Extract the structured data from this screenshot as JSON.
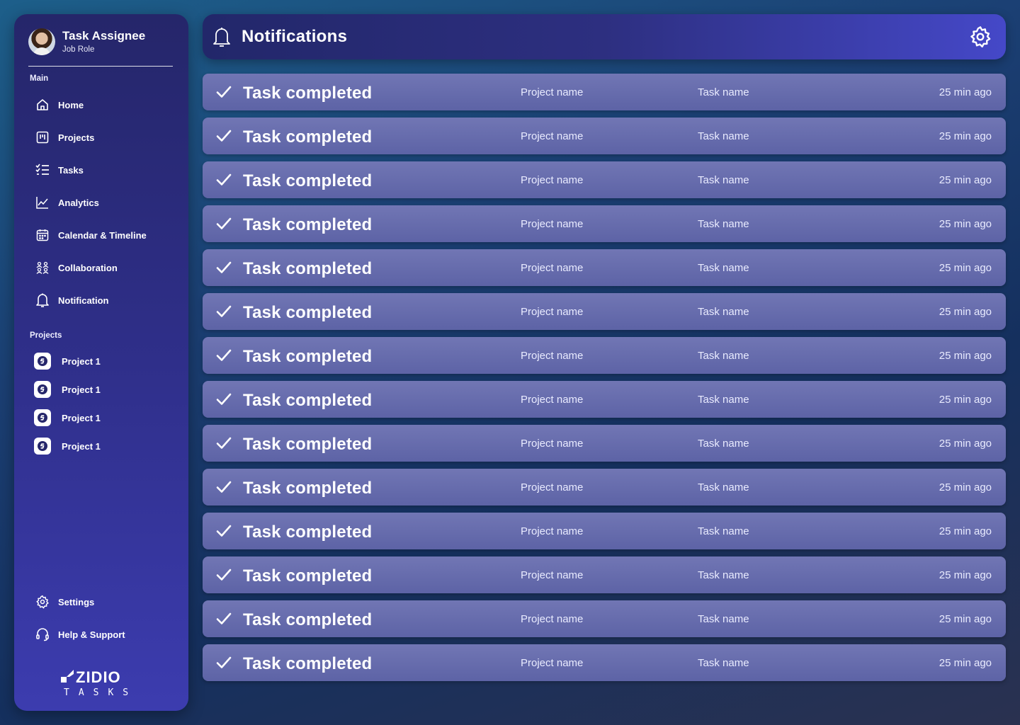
{
  "user": {
    "name": "Task Assignee",
    "role": "Job Role"
  },
  "sidebar": {
    "main_label": "Main",
    "nav": [
      {
        "label": "Home",
        "icon": "home-icon"
      },
      {
        "label": "Projects",
        "icon": "kanban-icon"
      },
      {
        "label": "Tasks",
        "icon": "tasks-icon"
      },
      {
        "label": "Analytics",
        "icon": "analytics-icon"
      },
      {
        "label": "Calendar & Timeline",
        "icon": "calendar-icon"
      },
      {
        "label": "Collaboration",
        "icon": "collaboration-icon"
      },
      {
        "label": "Notification",
        "icon": "bell-icon"
      }
    ],
    "projects_label": "Projects",
    "projects": [
      {
        "label": "Project 1",
        "icon": "project-s-icon"
      },
      {
        "label": "Project 1",
        "icon": "project-s-icon"
      },
      {
        "label": "Project 1",
        "icon": "project-s-icon"
      },
      {
        "label": "Project 1",
        "icon": "project-s-icon"
      }
    ],
    "bottom": [
      {
        "label": "Settings",
        "icon": "gear-icon"
      },
      {
        "label": "Help & Support",
        "icon": "headset-icon"
      }
    ],
    "logo": {
      "word": "ZIDIO",
      "sub": "TASKS"
    }
  },
  "header": {
    "title": "Notifications",
    "bell_icon": "bell-icon",
    "settings_icon": "gear-icon"
  },
  "notifications": [
    {
      "title": "Task completed",
      "project": "Project name",
      "task": "Task name",
      "time": "25 min ago",
      "icon": "check-icon"
    },
    {
      "title": "Task completed",
      "project": "Project name",
      "task": "Task name",
      "time": "25 min ago",
      "icon": "check-icon"
    },
    {
      "title": "Task completed",
      "project": "Project name",
      "task": "Task name",
      "time": "25 min ago",
      "icon": "check-icon"
    },
    {
      "title": "Task completed",
      "project": "Project name",
      "task": "Task name",
      "time": "25 min ago",
      "icon": "check-icon"
    },
    {
      "title": "Task completed",
      "project": "Project name",
      "task": "Task name",
      "time": "25 min ago",
      "icon": "check-icon"
    },
    {
      "title": "Task completed",
      "project": "Project name",
      "task": "Task name",
      "time": "25 min ago",
      "icon": "check-icon"
    },
    {
      "title": "Task completed",
      "project": "Project name",
      "task": "Task name",
      "time": "25 min ago",
      "icon": "check-icon"
    },
    {
      "title": "Task completed",
      "project": "Project name",
      "task": "Task name",
      "time": "25 min ago",
      "icon": "check-icon"
    },
    {
      "title": "Task completed",
      "project": "Project name",
      "task": "Task name",
      "time": "25 min ago",
      "icon": "check-icon"
    },
    {
      "title": "Task completed",
      "project": "Project name",
      "task": "Task name",
      "time": "25 min ago",
      "icon": "check-icon"
    },
    {
      "title": "Task completed",
      "project": "Project name",
      "task": "Task name",
      "time": "25 min ago",
      "icon": "check-icon"
    },
    {
      "title": "Task completed",
      "project": "Project name",
      "task": "Task name",
      "time": "25 min ago",
      "icon": "check-icon"
    },
    {
      "title": "Task completed",
      "project": "Project name",
      "task": "Task name",
      "time": "25 min ago",
      "icon": "check-icon"
    },
    {
      "title": "Task completed",
      "project": "Project name",
      "task": "Task name",
      "time": "25 min ago",
      "icon": "check-icon"
    }
  ]
}
